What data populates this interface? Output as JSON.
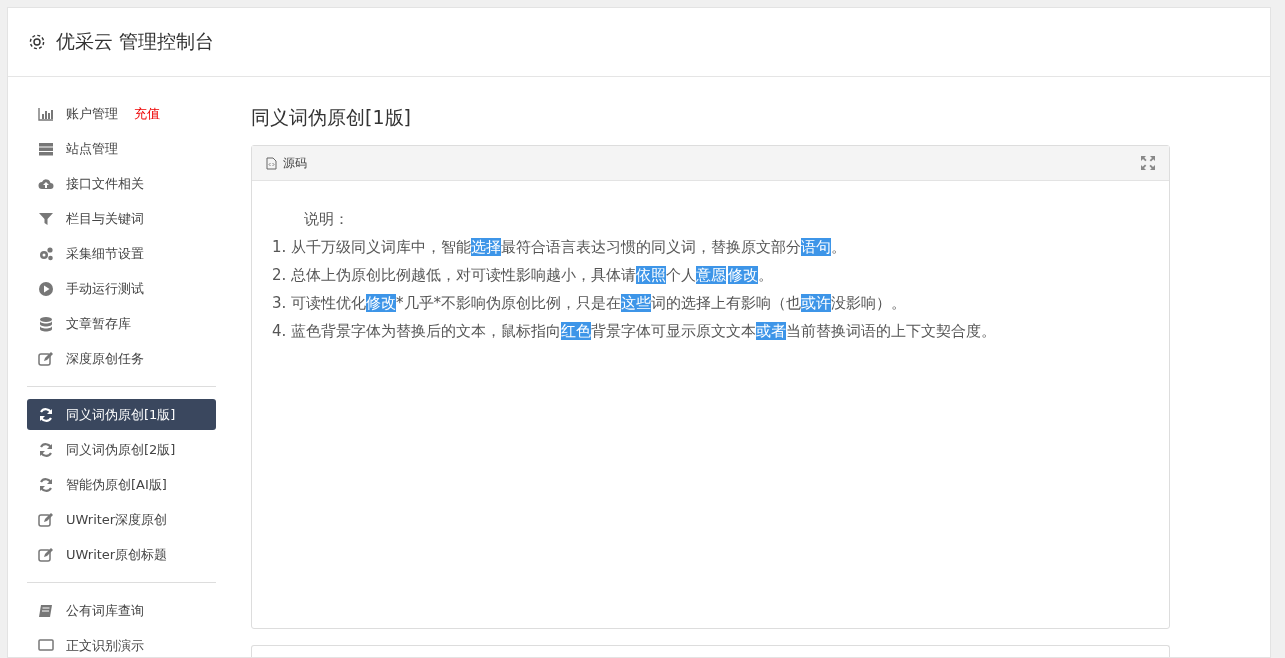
{
  "header": {
    "title": "优采云 管理控制台"
  },
  "sidebar": {
    "groups": [
      {
        "items": [
          {
            "label": "账户管理",
            "badge": "充值",
            "selected": false
          },
          {
            "label": "站点管理",
            "selected": false
          },
          {
            "label": "接口文件相关",
            "selected": false
          },
          {
            "label": "栏目与关键词",
            "selected": false
          },
          {
            "label": "采集细节设置",
            "selected": false
          },
          {
            "label": "手动运行测试",
            "selected": false
          },
          {
            "label": "文章暂存库",
            "selected": false
          },
          {
            "label": "深度原创任务",
            "selected": false
          }
        ]
      },
      {
        "items": [
          {
            "label": "同义词伪原创[1版]",
            "selected": true
          },
          {
            "label": "同义词伪原创[2版]",
            "selected": false
          },
          {
            "label": "智能伪原创[AI版]",
            "selected": false
          },
          {
            "label": "UWriter深度原创",
            "selected": false
          },
          {
            "label": "UWriter原创标题",
            "selected": false
          }
        ]
      },
      {
        "items": [
          {
            "label": "公有词库查询",
            "selected": false
          },
          {
            "label": "正文识别演示",
            "selected": false
          }
        ]
      }
    ]
  },
  "content": {
    "title": "同义词伪原创[1版]",
    "panel": {
      "tab": "源码",
      "heading": "说明：",
      "lines": [
        [
          {
            "text": "1. 从千万级同义词库中，智能",
            "highlighted": false
          },
          {
            "text": "选择",
            "highlighted": true
          },
          {
            "text": "最符合语言表达习惯的同义词，替换原文部分",
            "highlighted": false
          },
          {
            "text": "语句",
            "highlighted": true
          },
          {
            "text": "。",
            "highlighted": false
          }
        ],
        [
          {
            "text": "2. 总体上伪原创比例越低，对可读性影响越小，具体请",
            "highlighted": false
          },
          {
            "text": "依照",
            "highlighted": true
          },
          {
            "text": "个人",
            "highlighted": false
          },
          {
            "text": "意愿",
            "highlighted": true
          },
          {
            "text": "修改",
            "highlighted": true
          },
          {
            "text": "。",
            "highlighted": false
          }
        ],
        [
          {
            "text": "3. 可读性优化",
            "highlighted": false
          },
          {
            "text": "修改",
            "highlighted": true
          },
          {
            "text": "*几乎*不影响伪原创比例，只是在",
            "highlighted": false
          },
          {
            "text": "这些",
            "highlighted": true
          },
          {
            "text": "词的选择上有影响（也",
            "highlighted": false
          },
          {
            "text": "或许",
            "highlighted": true
          },
          {
            "text": "没影响）。",
            "highlighted": false
          }
        ],
        [
          {
            "text": "4. 蓝色背景字体为替换后的文本，鼠标指向",
            "highlighted": false
          },
          {
            "text": "红色",
            "highlighted": true
          },
          {
            "text": "背景字体可显示原文文本",
            "highlighted": false
          },
          {
            "text": "或者",
            "highlighted": true
          },
          {
            "text": "当前替换词语的上下文契合度。",
            "highlighted": false
          }
        ]
      ]
    }
  }
}
